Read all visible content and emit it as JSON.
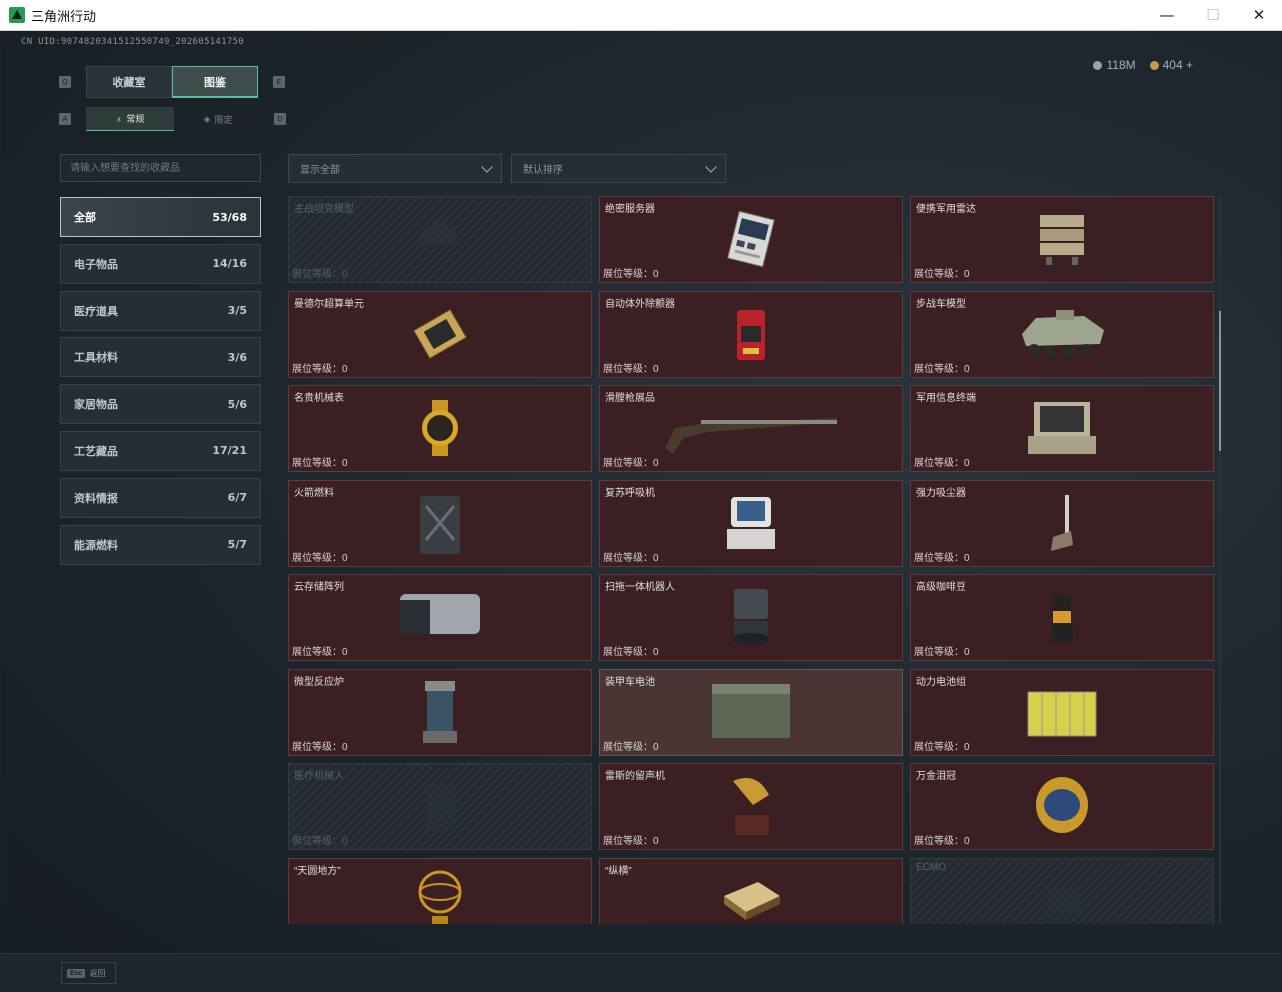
{
  "window": {
    "title": "三角洲行动",
    "minimize": "—",
    "maximize": "☐",
    "close": "✕"
  },
  "header": {
    "uid": "CN UID:9074820341512550749_202605141750",
    "currency": [
      {
        "icon": "silver-coin-icon",
        "value": "118M"
      },
      {
        "icon": "gold-coin-icon",
        "value": "404 +"
      }
    ]
  },
  "tabs": {
    "key_left": "Q",
    "key_right": "E",
    "items": [
      "收藏室",
      "图鉴"
    ],
    "active": 1
  },
  "subtabs": {
    "key_left": "A",
    "key_right": "D",
    "items": [
      "常规",
      "限定"
    ],
    "active": 0
  },
  "search": {
    "placeholder": "请输入想要查找的收藏品"
  },
  "categories": [
    {
      "label": "全部",
      "count": "53/68",
      "active": true
    },
    {
      "label": "电子物品",
      "count": "14/16"
    },
    {
      "label": "医疗道具",
      "count": "3/5"
    },
    {
      "label": "工具材料",
      "count": "3/6"
    },
    {
      "label": "家居物品",
      "count": "5/6"
    },
    {
      "label": "工艺藏品",
      "count": "17/21"
    },
    {
      "label": "资料情报",
      "count": "6/7"
    },
    {
      "label": "能源燃料",
      "count": "5/7"
    }
  ],
  "filters": {
    "display": "显示全部",
    "sort": "默认排序"
  },
  "level_label": "展位等级：",
  "items": [
    {
      "name": "主战坦克模型",
      "level": "0",
      "state": "locked",
      "icon": "tank-icon"
    },
    {
      "name": "绝密服务器",
      "level": "0",
      "state": "owned",
      "icon": "server-icon"
    },
    {
      "name": "便携军用雷达",
      "level": "0",
      "state": "owned",
      "icon": "radar-icon"
    },
    {
      "name": "曼德尔超算单元",
      "level": "0",
      "state": "owned",
      "icon": "cpu-icon"
    },
    {
      "name": "自动体外除颤器",
      "level": "0",
      "state": "owned",
      "icon": "defibrillator-icon"
    },
    {
      "name": "步战车模型",
      "level": "0",
      "state": "owned",
      "icon": "ifv-icon"
    },
    {
      "name": "名贵机械表",
      "level": "0",
      "state": "owned",
      "icon": "watch-icon"
    },
    {
      "name": "滑膛枪展品",
      "level": "0",
      "state": "owned",
      "icon": "musket-icon"
    },
    {
      "name": "军用信息终端",
      "level": "0",
      "state": "owned",
      "icon": "terminal-icon"
    },
    {
      "name": "火箭燃料",
      "level": "0",
      "state": "owned",
      "icon": "fuel-can-icon"
    },
    {
      "name": "复苏呼吸机",
      "level": "0",
      "state": "owned",
      "icon": "ventilator-icon"
    },
    {
      "name": "强力吸尘器",
      "level": "0",
      "state": "owned",
      "icon": "vacuum-icon"
    },
    {
      "name": "云存储阵列",
      "level": "0",
      "state": "owned",
      "icon": "storage-array-icon"
    },
    {
      "name": "扫拖一体机器人",
      "level": "0",
      "state": "owned",
      "icon": "robot-vacuum-icon"
    },
    {
      "name": "高级咖啡豆",
      "level": "0",
      "state": "owned",
      "icon": "coffee-bag-icon"
    },
    {
      "name": "微型反应炉",
      "level": "0",
      "state": "owned",
      "icon": "reactor-icon"
    },
    {
      "name": "装甲车电池",
      "level": "0",
      "state": "highlight",
      "icon": "battery-icon"
    },
    {
      "name": "动力电池组",
      "level": "0",
      "state": "owned",
      "icon": "battery-pack-icon"
    },
    {
      "name": "医疗机械人",
      "level": "0",
      "state": "locked",
      "icon": "med-robot-icon"
    },
    {
      "name": "雷斯的留声机",
      "level": "0",
      "state": "owned",
      "icon": "gramophone-icon"
    },
    {
      "name": "万金泪冠",
      "level": "0",
      "state": "owned",
      "icon": "crown-egg-icon"
    },
    {
      "name": "“天圆地方”",
      "level": "",
      "state": "owned",
      "icon": "armillary-icon"
    },
    {
      "name": "“纵横”",
      "level": "",
      "state": "owned",
      "icon": "chessboard-icon"
    },
    {
      "name": "ECMO",
      "level": "",
      "state": "locked",
      "icon": "ecmo-icon"
    }
  ],
  "footer": {
    "key": "Esc",
    "label": "返回"
  }
}
